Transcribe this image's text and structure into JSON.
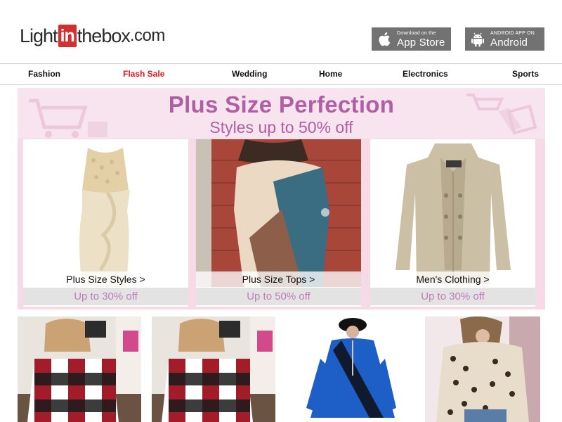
{
  "header": {
    "logo": {
      "part1": "Light",
      "part2": "in",
      "part3": "thebox",
      "part4": ".com"
    },
    "app_store": {
      "small": "Download on the",
      "big": "App Store",
      "icon": "apple-icon"
    },
    "android": {
      "small": "ANDROID APP ON",
      "big": "Android",
      "icon": "android-icon"
    }
  },
  "nav": {
    "items": [
      {
        "label": "Fashion"
      },
      {
        "label": "Flash Sale",
        "highlight": "#e8151b"
      },
      {
        "label": "Wedding"
      },
      {
        "label": "Home"
      },
      {
        "label": "Electronics"
      },
      {
        "label": "Sports"
      }
    ]
  },
  "banner": {
    "title": "Plus Size Perfection",
    "subtitle": "Styles up to 50% off",
    "accent_color": "#b05fa4",
    "cards": [
      {
        "label": "Plus Size Styles >",
        "discount": "Up to 30% off"
      },
      {
        "label": "Plus Size Tops >",
        "discount": "Up to 50% off"
      },
      {
        "label": "Men's Clothing >",
        "discount": "Up to 30% off"
      }
    ]
  },
  "products": [
    {
      "name": "plaid-top-product"
    },
    {
      "name": "plaid-top-product"
    },
    {
      "name": "blue-tunic-product"
    },
    {
      "name": "leopard-shirt-product"
    }
  ],
  "colors": {
    "brand_red": "#d32f2f",
    "store_button": "#727272",
    "banner_pink": "#f6dbe7"
  }
}
